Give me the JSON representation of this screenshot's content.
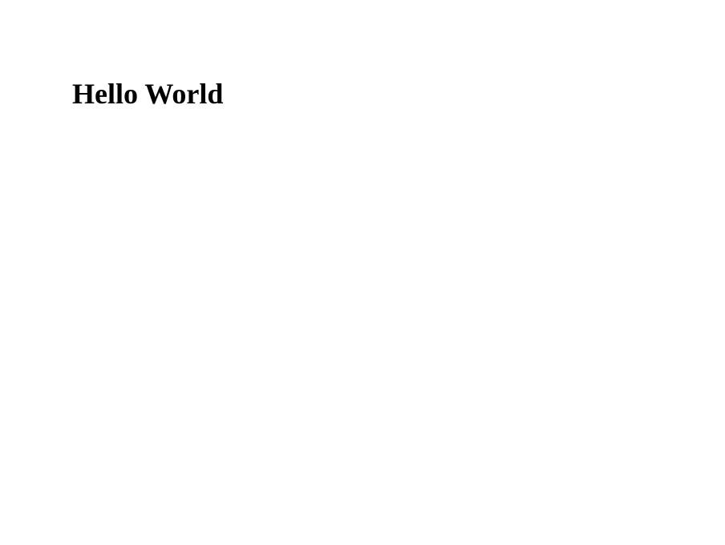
{
  "heading": "Hello World"
}
